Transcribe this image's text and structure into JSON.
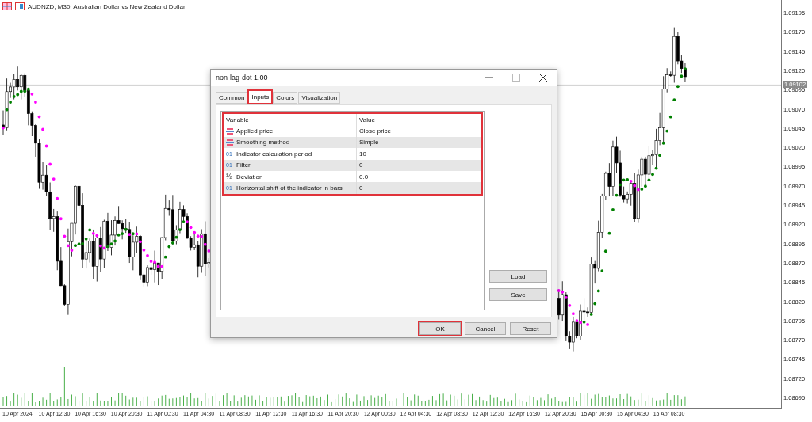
{
  "chart": {
    "title": "AUDNZD, M30:  Australian Dollar vs New Zealand Dollar",
    "price_axis": [
      "1.09195",
      "1.09170",
      "1.09145",
      "1.09120",
      "1.09095",
      "1.09070",
      "1.09045",
      "1.09020",
      "1.08995",
      "1.08970",
      "1.08945",
      "1.08920",
      "1.08895",
      "1.08870",
      "1.08845",
      "1.08820",
      "1.08795",
      "1.08770",
      "1.08745",
      "1.08720",
      "1.08695"
    ],
    "current_price": "1.09102",
    "time_axis": [
      "10 Apr 2024",
      "10 Apr 12:30",
      "10 Apr 16:30",
      "10 Apr 20:30",
      "11 Apr 00:30",
      "11 Apr 04:30",
      "11 Apr 08:30",
      "11 Apr 12:30",
      "11 Apr 16:30",
      "11 Apr 20:30",
      "12 Apr 00:30",
      "12 Apr 04:30",
      "12 Apr 08:30",
      "12 Apr 12:30",
      "12 Apr 16:30",
      "12 Apr 20:30",
      "15 Apr 00:30",
      "15 Apr 04:30",
      "15 Apr 08:30"
    ]
  },
  "dialog": {
    "title": "non-lag-dot 1.00",
    "tabs": [
      {
        "label": "Common",
        "selected": false,
        "highlighted": false
      },
      {
        "label": "Inputs",
        "selected": true,
        "highlighted": true
      },
      {
        "label": "Colors",
        "selected": false,
        "highlighted": false
      },
      {
        "label": "Visualization",
        "selected": false,
        "highlighted": false
      }
    ],
    "table": {
      "highlighted": true,
      "columns": [
        "Variable",
        "Value"
      ],
      "rows": [
        {
          "kind": "enum",
          "variable": "Applied price",
          "value": "Close price"
        },
        {
          "kind": "enum",
          "variable": "Smoothing method",
          "value": "Simple"
        },
        {
          "kind": "number",
          "glyph": "01",
          "variable": "Indicator calculation period",
          "value": "10"
        },
        {
          "kind": "number",
          "glyph": "01",
          "variable": "Filter",
          "value": "0"
        },
        {
          "kind": "fraction",
          "glyph": "½",
          "variable": "Deviation",
          "value": "0.0"
        },
        {
          "kind": "number",
          "glyph": "01",
          "variable": "Horizontal shift of the indicator in bars",
          "value": "0"
        }
      ]
    },
    "side_buttons": [
      "Load",
      "Save"
    ],
    "buttons": [
      {
        "label": "OK",
        "highlighted": true
      },
      {
        "label": "Cancel",
        "highlighted": false
      },
      {
        "label": "Reset",
        "highlighted": false
      }
    ]
  }
}
